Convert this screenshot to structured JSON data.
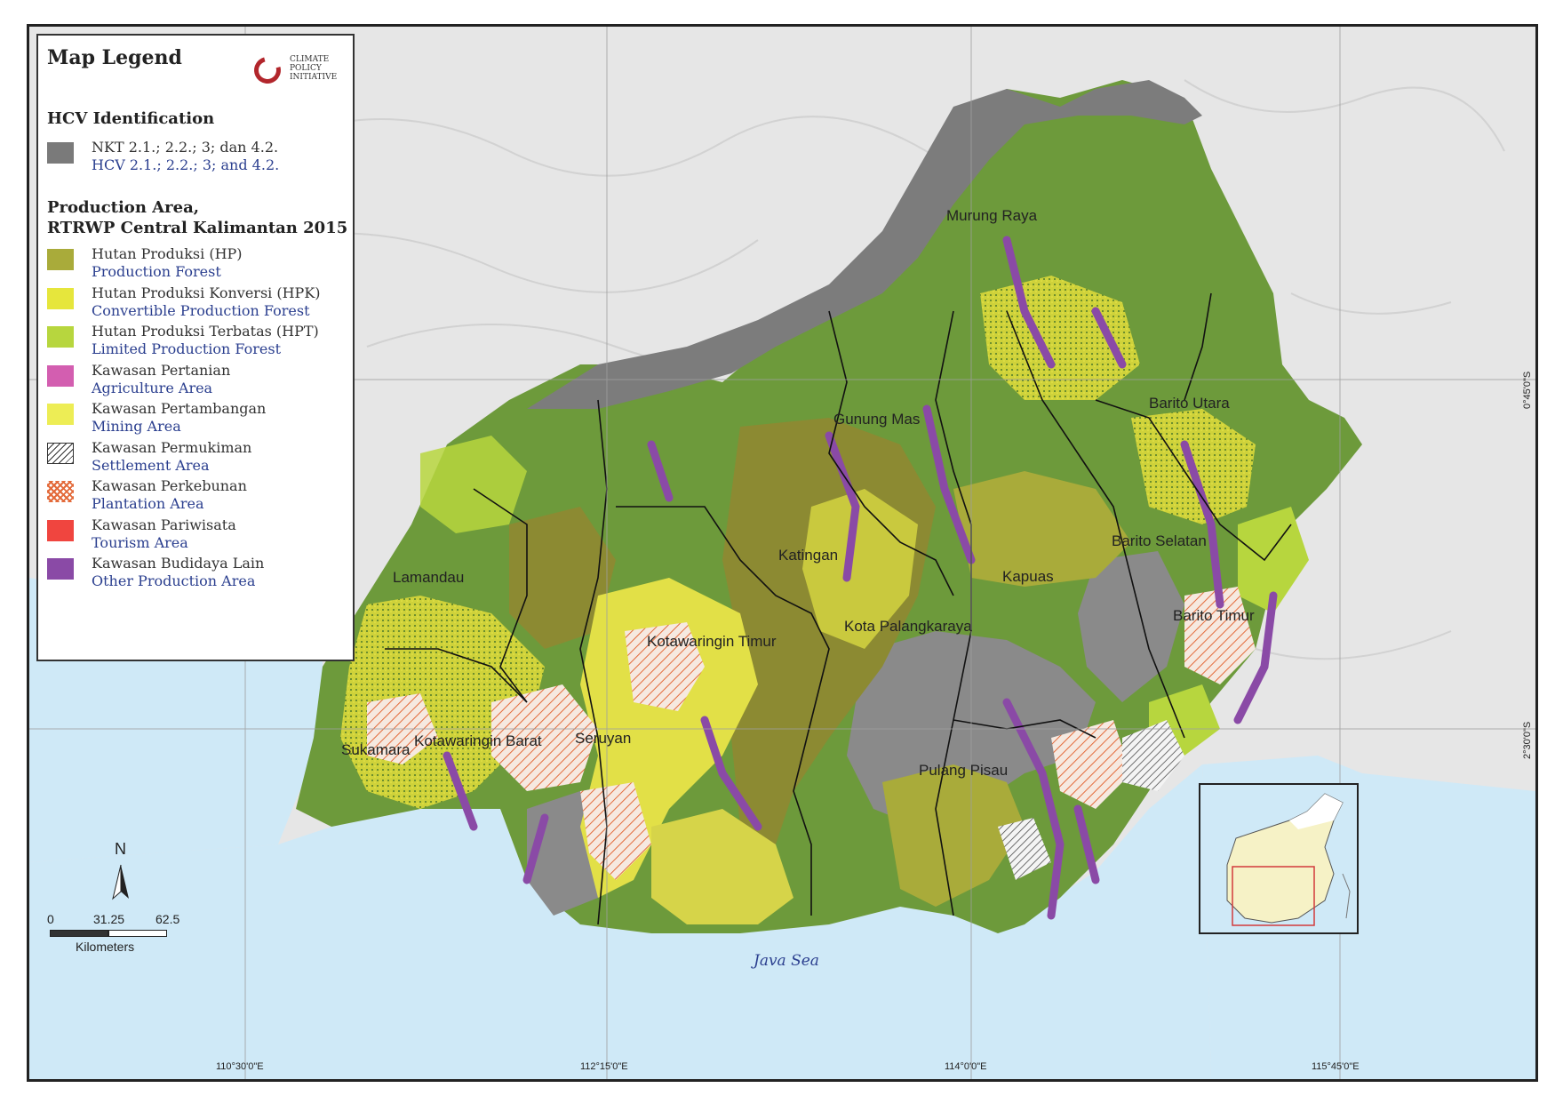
{
  "legend": {
    "title": "Map Legend",
    "logo_text": "CLIMATE\nPOLICY\nINITIATIVE",
    "hcv_section": "HCV Identification",
    "hcv_item": {
      "id": "NKT 2.1.; 2.2.; 3; dan 4.2.",
      "en": "HCV 2.1.; 2.2.; 3; and 4.2.",
      "color": "#7a7a7a"
    },
    "production_title_line1": "Production Area,",
    "production_title_line2": "RTRWP Central Kalimantan 2015",
    "items": [
      {
        "id": "Hutan Produksi (HP)",
        "en": "Production Forest",
        "color": "#a9ab3a"
      },
      {
        "id": "Hutan Produksi Konversi (HPK)",
        "en": "Convertible Production Forest",
        "color": "#e6e63c"
      },
      {
        "id": "Hutan Produksi Terbatas (HPT)",
        "en": "Limited Production Forest",
        "color": "#b7d63e"
      },
      {
        "id": "Kawasan Pertanian",
        "en": "Agriculture Area",
        "color": "#d35eb0"
      },
      {
        "id": "Kawasan Pertambangan",
        "en": "Mining Area",
        "color": "#eded55"
      },
      {
        "id": "Kawasan Permukiman",
        "en": "Settlement Area",
        "color": "hatch-black"
      },
      {
        "id": "Kawasan Perkebunan",
        "en": "Plantation Area",
        "color": "hatch-orange"
      },
      {
        "id": "Kawasan Pariwisata",
        "en": "Tourism Area",
        "color": "#f0453f"
      },
      {
        "id": "Kawasan Budidaya Lain",
        "en": "Other Production Area",
        "color": "#8a4aa6"
      }
    ]
  },
  "regions": {
    "murung_raya": "Murung Raya",
    "gunung_mas": "Gunung Mas",
    "barito_utara": "Barito Utara",
    "barito_selatan": "Barito Selatan",
    "barito_timur": "Barito Timur",
    "kapuas": "Kapuas",
    "katingan": "Katingan",
    "kota_palangkaraya": "Kota Palangkaraya",
    "lamandau": "Lamandau",
    "kotawaringin_timur": "Kotawaringin Timur",
    "kotawaringin_barat": "Kotawaringin Barat",
    "sukamara": "Sukamara",
    "seruyan": "Seruyan",
    "pulang_pisau": "Pulang Pisau"
  },
  "sea_label": "Java Sea",
  "coords": {
    "lon1": "110°30'0\"E",
    "lon2": "112°15'0\"E",
    "lon3": "114°0'0\"E",
    "lon4": "115°45'0\"E",
    "lat1": "0°45'0\"S",
    "lat2": "2°30'0\"S"
  },
  "north_arrow": "N",
  "scale": {
    "t0": "0",
    "t1": "31.25",
    "t2": "62.5",
    "unit": "Kilometers"
  }
}
